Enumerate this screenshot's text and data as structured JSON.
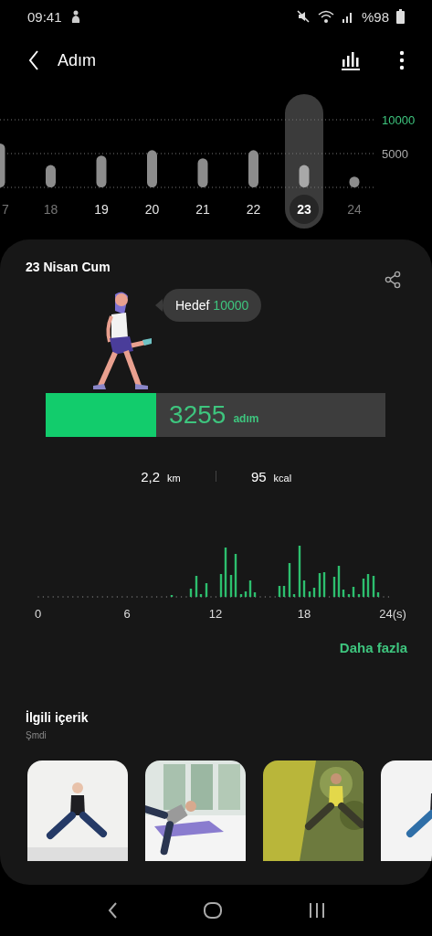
{
  "status_bar": {
    "time": "09:41",
    "battery": "%98"
  },
  "app_bar": {
    "title": "Adım"
  },
  "day_chart": {
    "chart_data": {
      "type": "bar",
      "categories": [
        "7",
        "18",
        "19",
        "20",
        "21",
        "22",
        "23",
        "24"
      ],
      "values": [
        6500,
        3300,
        4700,
        5500,
        4300,
        5500,
        3300,
        1600
      ],
      "ylim": [
        0,
        10000
      ],
      "yticks": [
        {
          "value": 5000,
          "label": "5000"
        },
        {
          "value": 10000,
          "label": "10000"
        }
      ]
    },
    "days": [
      {
        "selected": false,
        "dimmed": true
      },
      {
        "selected": false,
        "dimmed": true
      },
      {
        "selected": false,
        "dimmed": false
      },
      {
        "selected": false,
        "dimmed": false
      },
      {
        "selected": false,
        "dimmed": false
      },
      {
        "selected": false,
        "dimmed": false
      },
      {
        "selected": true,
        "dimmed": false
      },
      {
        "selected": false,
        "dimmed": true
      }
    ]
  },
  "summary": {
    "date": "23 Nisan Cum",
    "goal": {
      "label": "Hedef",
      "value": "10000"
    },
    "steps": {
      "count": "3255",
      "unit": "adım",
      "level": 0.3255
    },
    "stats": [
      {
        "value": "2,2",
        "unit": "km"
      },
      {
        "value": "95",
        "unit": "kcal"
      }
    ],
    "hourly_labels": [
      "0",
      "6",
      "12",
      "18",
      "24(s)"
    ],
    "more_link": "Daha fazla"
  },
  "related": {
    "title": "İlgili içerik",
    "subtitle": "Şmdi"
  }
}
